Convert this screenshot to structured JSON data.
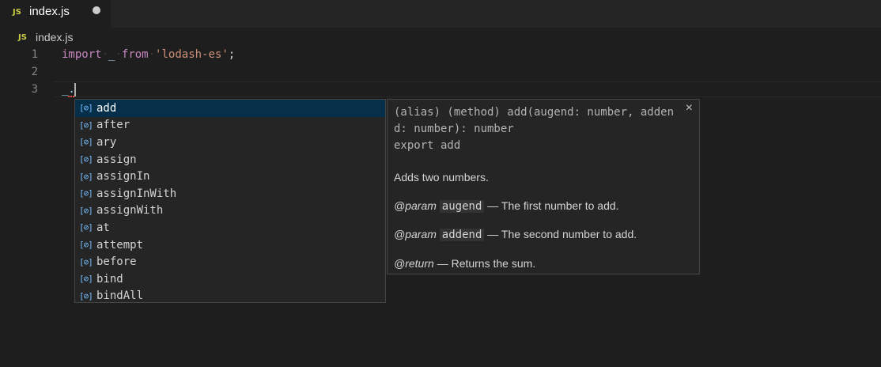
{
  "tab": {
    "badge": "JS",
    "title": "index.js"
  },
  "breadcrumb": {
    "badge": "JS",
    "file": "index.js"
  },
  "lines": [
    {
      "number": "1"
    },
    {
      "number": "2"
    },
    {
      "number": "3"
    }
  ],
  "code": {
    "line1": {
      "kw_import": "import",
      "ws1": "·",
      "underscore": "_",
      "ws2": "·",
      "kw_from": "from",
      "ws3": "·",
      "str": "'lodash-es'",
      "semi": ";"
    },
    "line3": {
      "text": "_."
    }
  },
  "suggest": {
    "icon": "[⊘]",
    "items": [
      {
        "label": "add"
      },
      {
        "label": "after"
      },
      {
        "label": "ary"
      },
      {
        "label": "assign"
      },
      {
        "label": "assignIn"
      },
      {
        "label": "assignInWith"
      },
      {
        "label": "assignWith"
      },
      {
        "label": "at"
      },
      {
        "label": "attempt"
      },
      {
        "label": "before"
      },
      {
        "label": "bind"
      },
      {
        "label": "bindAll"
      }
    ],
    "selected_index": 0
  },
  "details": {
    "signature": "(alias) (method) add(augend: number, addend: number): number\nexport add",
    "close_icon": "×",
    "description": "Adds two numbers.",
    "param1": {
      "tag": "@param",
      "name": "augend",
      "text": "— The first number to add."
    },
    "param2": {
      "tag": "@param",
      "name": "addend",
      "text": "— The second number to add."
    },
    "returns": {
      "tag": "@return",
      "text": "— Returns the sum."
    }
  },
  "colors": {
    "background": "#1e1e1e",
    "keyword": "#c586c0",
    "string": "#ce9178",
    "selection": "#062f4a",
    "icon": "#75beff"
  }
}
